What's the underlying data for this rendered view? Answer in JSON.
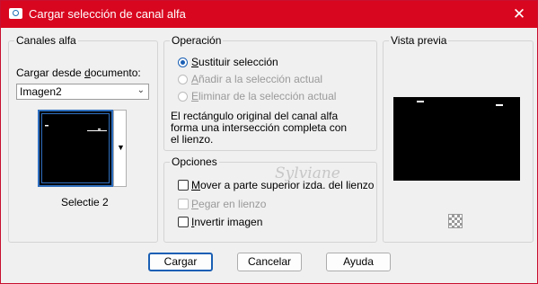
{
  "window": {
    "title": "Cargar selección de canal alfa",
    "accent": "#d8071f"
  },
  "canales": {
    "legend": "Canales alfa",
    "load_label_pre": "Cargar desde ",
    "load_label_u": "d",
    "load_label_post": "ocumento:",
    "document_value": "Imagen2",
    "selection_name": "Selectie 2"
  },
  "operacion": {
    "legend": "Operación",
    "options": [
      {
        "u": "S",
        "rest": "ustituir selección",
        "selected": true,
        "enabled": true
      },
      {
        "u": "A",
        "rest": "ñadir a la selección actual",
        "selected": false,
        "enabled": false
      },
      {
        "u": "E",
        "rest": "liminar de la selección actual",
        "selected": false,
        "enabled": false
      }
    ],
    "info": [
      "El rectángulo original del canal alfa",
      "forma una intersección completa con",
      "el lienzo."
    ]
  },
  "opciones": {
    "legend": "Opciones",
    "items": [
      {
        "u": "M",
        "rest": "over a parte superior izda. del lienzo",
        "checked": false,
        "enabled": true
      },
      {
        "u": "P",
        "rest": "egar en lienzo",
        "checked": false,
        "enabled": false
      },
      {
        "u": "I",
        "rest": "nvertir imagen",
        "checked": false,
        "enabled": true
      }
    ]
  },
  "vista": {
    "legend": "Vista previa"
  },
  "buttons": {
    "ok": "Cargar",
    "cancel": "Cancelar",
    "help": "Ayuda"
  },
  "watermark": "Sylviane"
}
